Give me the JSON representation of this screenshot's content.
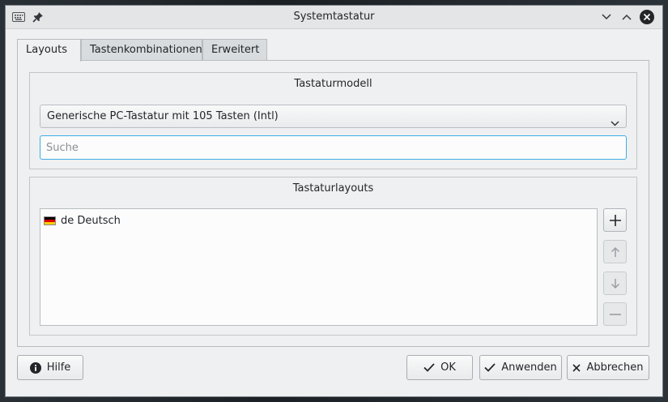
{
  "window": {
    "title": "Systemtastatur"
  },
  "tabs": [
    {
      "label": "Layouts",
      "active": true
    },
    {
      "label": "Tastenkombinationen",
      "active": false
    },
    {
      "label": "Erweitert",
      "active": false
    }
  ],
  "keyboard_model": {
    "group_title": "Tastaturmodell",
    "selected": "Generische PC-Tastatur mit 105 Tasten (Intl)",
    "search_placeholder": "Suche",
    "search_value": ""
  },
  "layouts": {
    "group_title": "Tastaturlayouts",
    "items": [
      {
        "code": "de",
        "name": "Deutsch",
        "flag": "german-flag-icon"
      }
    ],
    "flag_colors": [
      "#000000",
      "#dd0000",
      "#ffce00"
    ]
  },
  "buttons": {
    "help": "Hilfe",
    "ok": "OK",
    "apply": "Anwenden",
    "cancel": "Abbrechen"
  },
  "colors": {
    "focus": "#3daee9",
    "close_button": "#232629"
  }
}
